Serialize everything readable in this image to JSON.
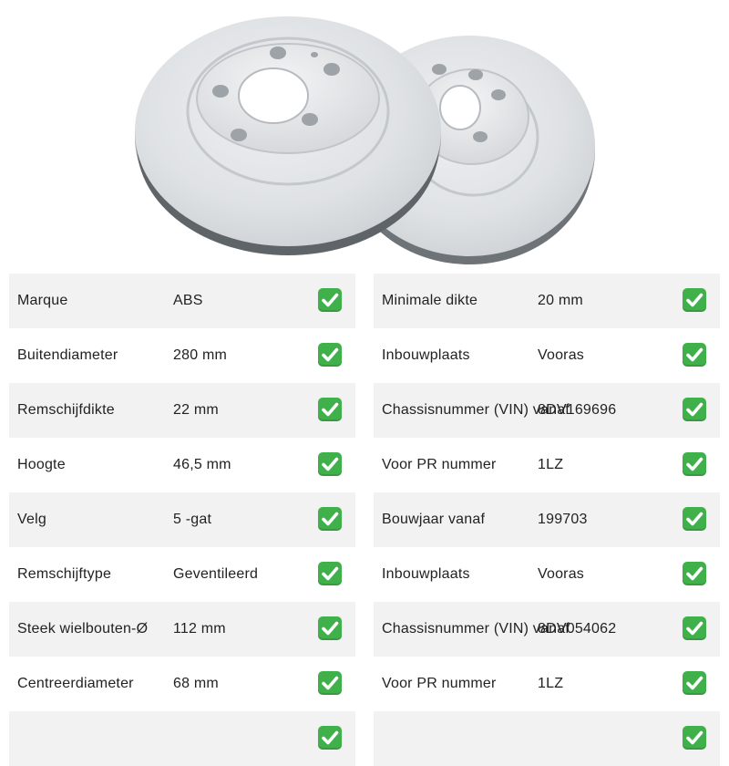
{
  "product": {
    "image_alt": "Remschijven (2 stuks, geventileerd)"
  },
  "specs_left": [
    {
      "label": "Marque",
      "value": "ABS",
      "check": "check-icon"
    },
    {
      "label": "Buitendiameter",
      "value": "280 mm",
      "check": "check-icon"
    },
    {
      "label": "Remschijfdikte",
      "value": "22 mm",
      "check": "check-icon"
    },
    {
      "label": "Hoogte",
      "value": "46,5 mm",
      "check": "check-icon"
    },
    {
      "label": "Velg",
      "value": "5 -gat",
      "check": "check-icon"
    },
    {
      "label": "Remschijftype",
      "value": "Geventileerd",
      "check": "check-icon"
    },
    {
      "label": "Steek wielbouten-Ø",
      "value": "112 mm",
      "check": "check-icon"
    },
    {
      "label": "Centreerdiameter",
      "value": "68 mm",
      "check": "check-icon"
    },
    {
      "label": "",
      "value": "",
      "check": "check-icon"
    }
  ],
  "specs_right": [
    {
      "label": "Minimale dikte",
      "value": "20 mm",
      "check": "check-icon"
    },
    {
      "label": "Inbouwplaats",
      "value": "Vooras",
      "check": "check-icon"
    },
    {
      "label": "Chassisnummer (VIN) vanaf",
      "value": "8DV169696",
      "check": "check-icon"
    },
    {
      "label": "Voor PR nummer",
      "value": "1LZ",
      "check": "check-icon"
    },
    {
      "label": "Bouwjaar vanaf",
      "value": "199703",
      "check": "check-icon"
    },
    {
      "label": "Inbouwplaats",
      "value": "Vooras",
      "check": "check-icon"
    },
    {
      "label": "Chassisnummer (VIN) vanaf",
      "value": "8DV054062",
      "check": "check-icon"
    },
    {
      "label": "Voor PR nummer",
      "value": "1LZ",
      "check": "check-icon"
    },
    {
      "label": "",
      "value": "",
      "check": "check-icon"
    }
  ],
  "colors": {
    "row_shade": "#f2f2f2",
    "check_green": "#3fb04a",
    "disc_grey": "#d9dcdf"
  }
}
